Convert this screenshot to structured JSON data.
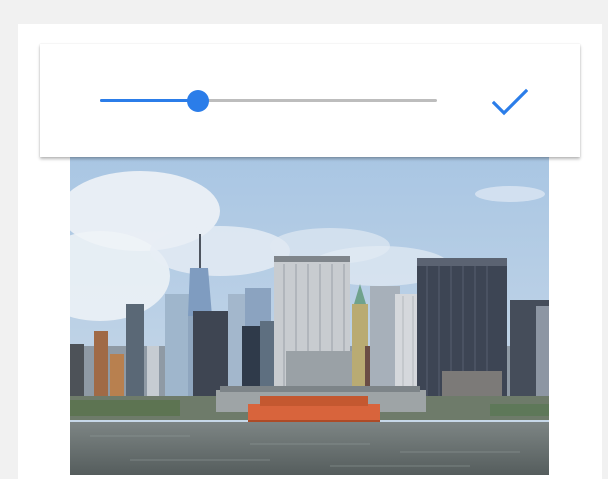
{
  "editor": {
    "slider": {
      "value": 0.29,
      "fill_color": "#2b7de9",
      "track_color": "#bdbdbd"
    },
    "confirm_icon": "checkmark-icon",
    "confirm_color": "#2b7de9"
  },
  "photo": {
    "subject": "city-skyline-photo"
  }
}
